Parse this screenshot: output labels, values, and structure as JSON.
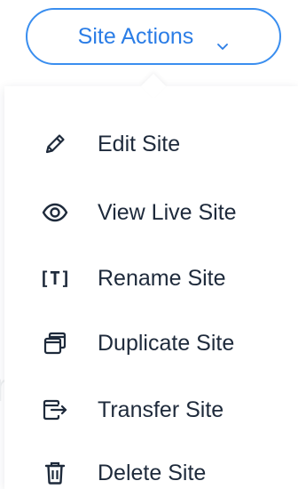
{
  "button": {
    "label": "Site Actions",
    "icon": "chevron-down-icon",
    "color": "#3a8eef"
  },
  "menu": {
    "items": [
      {
        "label": "Edit Site",
        "icon": "pencil-icon"
      },
      {
        "label": "View Live Site",
        "icon": "eye-icon"
      },
      {
        "label": "Rename Site",
        "icon": "rename-icon",
        "icon_text": "[T]"
      },
      {
        "label": "Duplicate Site",
        "icon": "duplicate-icon"
      },
      {
        "label": "Transfer Site",
        "icon": "transfer-icon"
      },
      {
        "label": "Delete Site",
        "icon": "trash-icon"
      }
    ]
  },
  "colors": {
    "accent": "#3a8eef",
    "text": "#1e2a3b"
  }
}
